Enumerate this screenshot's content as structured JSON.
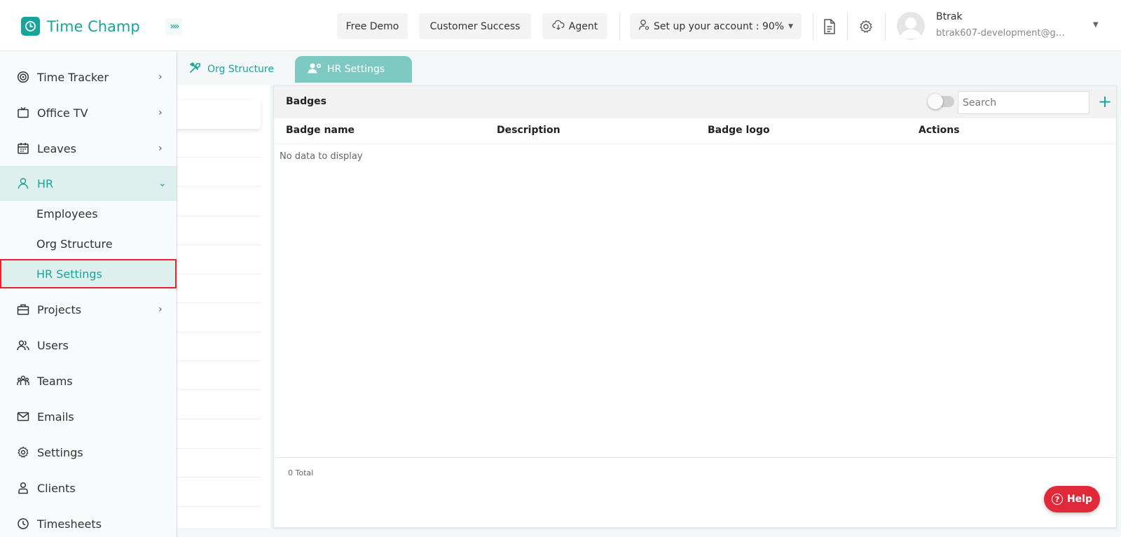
{
  "app": {
    "name": "Time Champ",
    "collapse_glyph": "»»"
  },
  "topbar": {
    "free_demo": "Free Demo",
    "customer_success": "Customer Success",
    "agent": "Agent",
    "setup": "Set up your account : 90%",
    "user_name": "Btrak",
    "user_email": "btrak607-development@gm..."
  },
  "tabs": [
    {
      "label": "Org Structure",
      "icon": "tools-icon"
    },
    {
      "label": "HR Settings",
      "icon": "user-gear-icon"
    }
  ],
  "sidebar": {
    "items": [
      {
        "label": "Time Tracker",
        "icon": "target-icon",
        "chevron": "›"
      },
      {
        "label": "Office TV",
        "icon": "tv-icon",
        "chevron": "›"
      },
      {
        "label": "Leaves",
        "icon": "calendar-icon",
        "chevron": "›"
      },
      {
        "label": "HR",
        "icon": "user-icon",
        "chevron": "⌄"
      },
      {
        "label": "Projects",
        "icon": "briefcase-icon",
        "chevron": "›"
      },
      {
        "label": "Users",
        "icon": "users-icon",
        "chevron": ""
      },
      {
        "label": "Teams",
        "icon": "team-icon",
        "chevron": ""
      },
      {
        "label": "Emails",
        "icon": "mail-icon",
        "chevron": ""
      },
      {
        "label": "Settings",
        "icon": "gear-icon",
        "chevron": ""
      },
      {
        "label": "Clients",
        "icon": "client-icon",
        "chevron": ""
      },
      {
        "label": "Timesheets",
        "icon": "clock-icon",
        "chevron": ""
      }
    ],
    "hr_sub": [
      {
        "label": "Employees"
      },
      {
        "label": "Org Structure"
      },
      {
        "label": "HR Settings"
      }
    ]
  },
  "badges": {
    "title": "Badges",
    "search_placeholder": "Search",
    "add_glyph": "+",
    "columns": [
      "Badge name",
      "Description",
      "Badge logo",
      "Actions"
    ],
    "empty_text": "No data to display",
    "total": "0 Total"
  },
  "help": {
    "label": "Help",
    "glyph": "?"
  },
  "colors": {
    "accent": "#1aa39a",
    "tab_active": "#7fc9c3",
    "nav_active_bg": "#ddf0ee",
    "highlight_border": "#e0262f",
    "help_bg": "#e02a3a"
  }
}
